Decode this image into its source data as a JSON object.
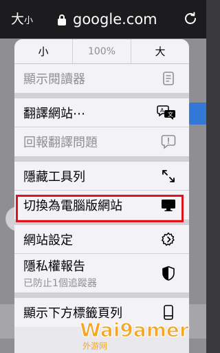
{
  "address_bar": {
    "aa_large": "大",
    "aa_small": "小",
    "domain": "google.com"
  },
  "zoom": {
    "decrease": "小",
    "percent": "100%",
    "increase": "大"
  },
  "menu": {
    "show_reader": "顯示閱讀器",
    "translate": "翻譯網站⋯",
    "report_translation": "回報翻譯問題",
    "hide_toolbar": "隱藏工具列",
    "request_desktop": "切換為電腦版網站",
    "website_settings": "網站設定",
    "privacy_report": "隱私權報告",
    "privacy_report_sub": "已防止1個追蹤器",
    "show_bottom_tab": "顯示下方標籤頁列"
  },
  "watermark": {
    "brand": "Wai9amer",
    "brand_cn": "外游网"
  },
  "colors": {
    "highlight": "#e0131b",
    "accent": "#1a73e8",
    "watermark": "#f6a623"
  },
  "icons": {
    "reader": "reader-icon",
    "translate": "translate-icon",
    "report": "report-bubble-icon",
    "hide_toolbar": "arrows-expand-icon",
    "desktop": "desktop-icon",
    "settings": "gear-icon",
    "privacy": "shield-icon",
    "tabs": "phone-tab-icon",
    "lock": "lock-icon",
    "reload": "reload-icon"
  }
}
